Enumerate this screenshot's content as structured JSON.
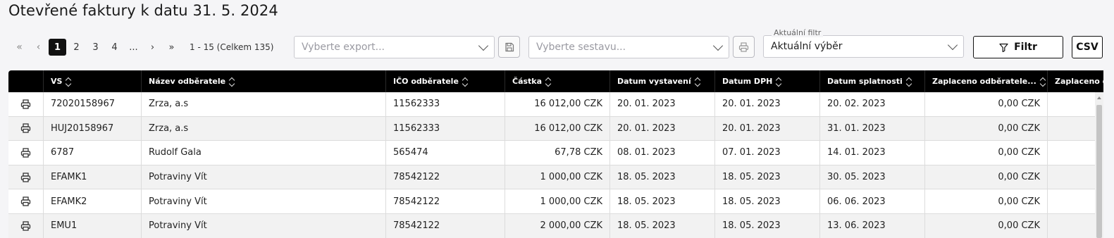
{
  "title": "Otevřené faktury k datu 31. 5. 2024",
  "pager": {
    "first": "«",
    "prev": "‹",
    "pages": [
      "1",
      "2",
      "3",
      "4",
      "..."
    ],
    "active_page": "1",
    "next": "›",
    "last": "»",
    "info": "1 - 15 (Celkem 135)"
  },
  "export_select": {
    "placeholder": "Vyberte export..."
  },
  "report_select": {
    "placeholder": "Vyberte sestavu..."
  },
  "filter_select": {
    "label": "Aktuální filtr",
    "value": "Aktuální výběr"
  },
  "filter_button": {
    "label": "Filtr"
  },
  "csv_button": {
    "label": "CSV"
  },
  "table": {
    "headers": [
      "VS",
      "Název odběratele",
      "IČO odběratele",
      "Částka",
      "Datum vystavení",
      "Datum DPH",
      "Datum splatnosti",
      "Zaplaceno odběratele...",
      "Zaplaceno do"
    ],
    "rows": [
      [
        "72020158967",
        "Zrza, a.s",
        "11562333",
        "16 012,00 CZK",
        "20. 01. 2023",
        "20. 01. 2023",
        "20. 02. 2023",
        "0,00 CZK",
        ""
      ],
      [
        "HUJ20158967",
        "Zrza, a.s",
        "11562333",
        "16 012,00 CZK",
        "20. 01. 2023",
        "20. 01. 2023",
        "31. 01. 2023",
        "0,00 CZK",
        ""
      ],
      [
        "6787",
        "Rudolf Gala",
        "565474",
        "67,78 CZK",
        "08. 01. 2023",
        "07. 01. 2023",
        "14. 01. 2023",
        "0,00 CZK",
        ""
      ],
      [
        "EFAMK1",
        "Potraviny Vít",
        "78542122",
        "1 000,00 CZK",
        "18. 05. 2023",
        "18. 05. 2023",
        "30. 05. 2023",
        "0,00 CZK",
        ""
      ],
      [
        "EFAMK2",
        "Potraviny Vít",
        "78542122",
        "1 000,00 CZK",
        "18. 05. 2023",
        "18. 05. 2023",
        "06. 06. 2023",
        "0,00 CZK",
        ""
      ],
      [
        "EMU1",
        "Potraviny Vít",
        "78542122",
        "2 000,00 CZK",
        "18. 05. 2023",
        "18. 05. 2023",
        "13. 06. 2023",
        "0,00 CZK",
        ""
      ]
    ]
  },
  "icons": {
    "row_action": "printer-icon",
    "export_action": "save-icon",
    "report_action": "printer-icon",
    "filter": "funnel-icon"
  },
  "colors": {
    "header_bg": "#000000",
    "active_page_bg": "#111111"
  }
}
